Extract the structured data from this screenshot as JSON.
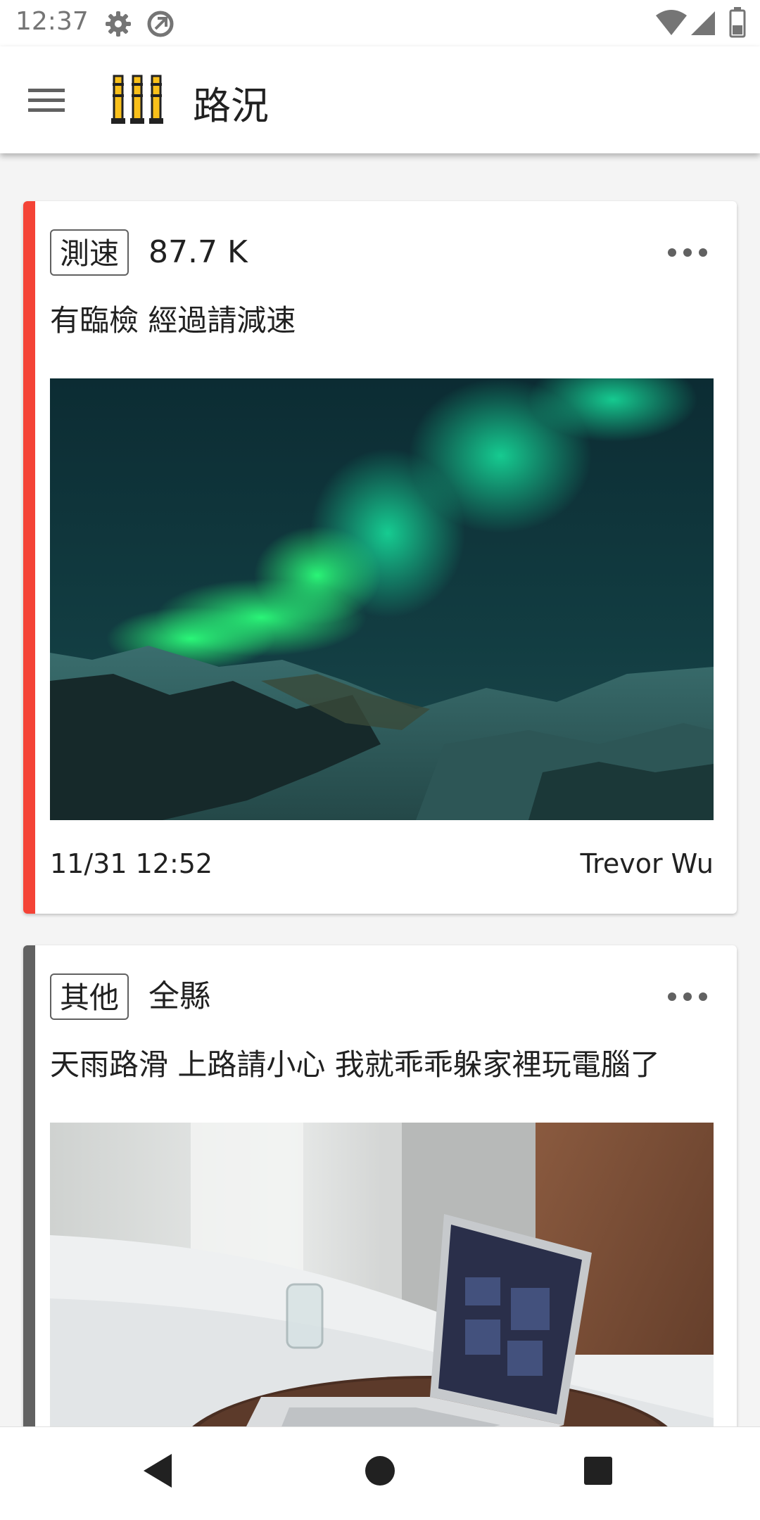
{
  "status_bar": {
    "time": "12:37",
    "icons": [
      "gear-icon",
      "sync-icon",
      "wifi-icon",
      "cellular-signal-icon",
      "battery-icon"
    ]
  },
  "app_bar": {
    "title": "路況",
    "menu_icon": "hamburger-icon",
    "logo_icon": "road-barrier-icon"
  },
  "colors": {
    "accent_red": "#f44336",
    "accent_gray": "#616161",
    "logo_yellow": "#f9c01a"
  },
  "posts": [
    {
      "tag": "測速",
      "meta": "87.7 K",
      "message": "有臨檢 經過請減速",
      "photo": "aurora-over-snowy-mountains",
      "time": "11/31 12:52",
      "author": "Trevor Wu",
      "accent": "#f44336"
    },
    {
      "tag": "其他",
      "meta": "全縣",
      "message": "天雨路滑 上路請小心 我就乖乖躲家裡玩電腦了",
      "photo": "laptop-on-bedside-table",
      "accent": "#616161"
    }
  ],
  "nav_bar": {
    "icons": [
      "back-icon",
      "home-icon",
      "recents-icon"
    ]
  }
}
